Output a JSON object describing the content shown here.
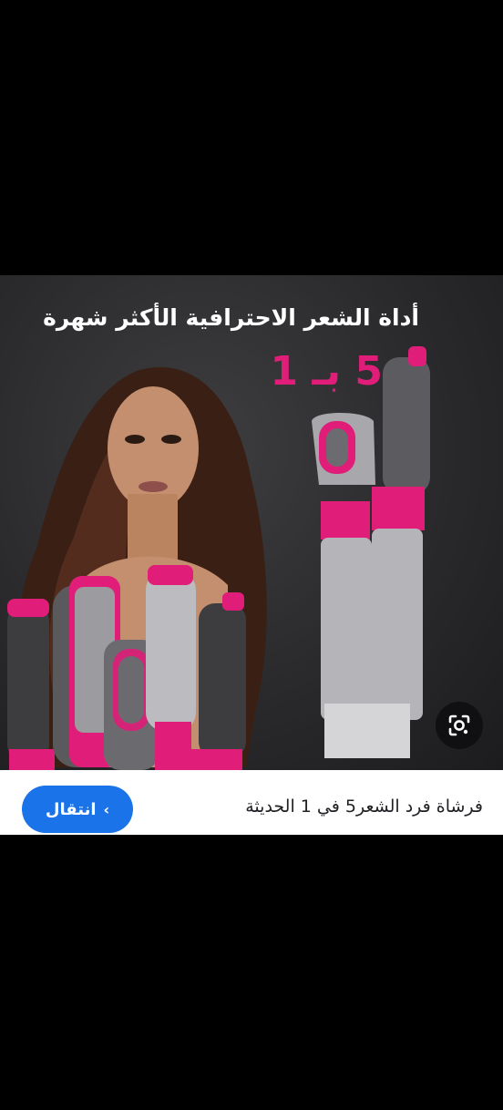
{
  "product_image": {
    "headline": "أداة الشعر الاحترافية الأكثر شهرة",
    "subhead": "5 بـ 1"
  },
  "result": {
    "title": "فرشاة فرد الشعر5 في 1 الحديثة",
    "visit_label": "انتقال",
    "visit_chevron": "‹"
  },
  "icons": {
    "lens": "google-lens-icon",
    "chevron": "chevron-left-icon"
  },
  "colors": {
    "accent_magenta": "#e01d78",
    "button_blue": "#1a73e8",
    "background": "#000000"
  }
}
